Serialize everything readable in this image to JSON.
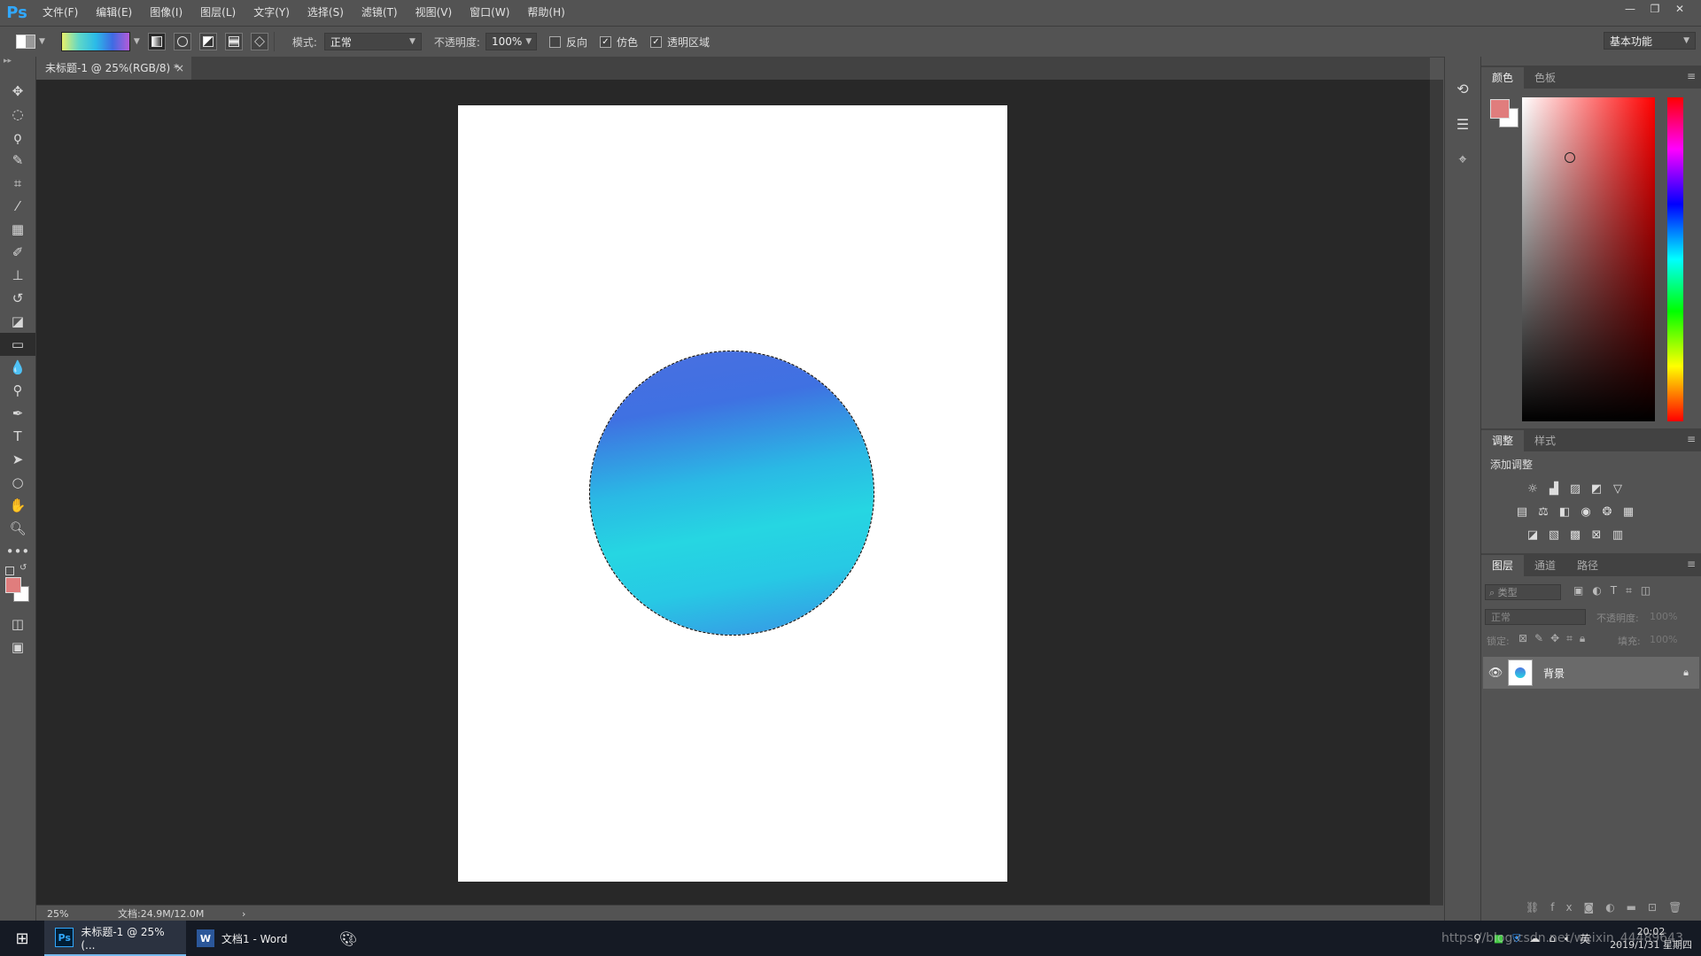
{
  "app": {
    "logo": "Ps",
    "menu": [
      "文件(F)",
      "编辑(E)",
      "图像(I)",
      "图层(L)",
      "文字(Y)",
      "选择(S)",
      "滤镜(T)",
      "视图(V)",
      "窗口(W)",
      "帮助(H)"
    ],
    "window_controls": [
      "—",
      "❐",
      "✕"
    ]
  },
  "options": {
    "mode_label": "模式:",
    "mode_value": "正常",
    "opacity_label": "不透明度:",
    "opacity_value": "100%",
    "reverse_label": "反向",
    "reverse_checked": false,
    "dither_label": "仿色",
    "dither_checked": true,
    "transparency_label": "透明区域",
    "transparency_checked": true,
    "workspace": "基本功能",
    "gradient_colors": [
      "#e8f06a",
      "#5fd7c8",
      "#2bbbe8",
      "#3f6be3",
      "#b35bd9"
    ]
  },
  "document": {
    "tab_title": "未标题-1 @ 25%(RGB/8) *",
    "tab_close": "×",
    "zoom": "25%",
    "doc_size": "文档:24.9M/12.0M",
    "status_arrow": "›"
  },
  "panels": {
    "color_tabs": [
      "颜色",
      "色板"
    ],
    "adjust_tabs": [
      "调整",
      "样式"
    ],
    "add_adjustment": "添加调整",
    "layers_tabs": [
      "图层",
      "通道",
      "路径"
    ],
    "layer_filter": "类型",
    "blend_mode": "正常",
    "opacity_label": "不透明度:",
    "opacity_value": "100%",
    "lock_label": "锁定:",
    "fill_label": "填充:",
    "fill_value": "100%",
    "layer_name": "背景",
    "foreground_color": "#e07d7d",
    "background_color": "#ffffff"
  },
  "taskbar": {
    "ps_window": "未标题-1 @ 25%(...",
    "word_window": "文档1 - Word",
    "clock_time": "20:02",
    "clock_date": "2019/1/31 星期四",
    "ime": "英",
    "watermark": "https://blog.csdn.net/weixin_44489643"
  }
}
